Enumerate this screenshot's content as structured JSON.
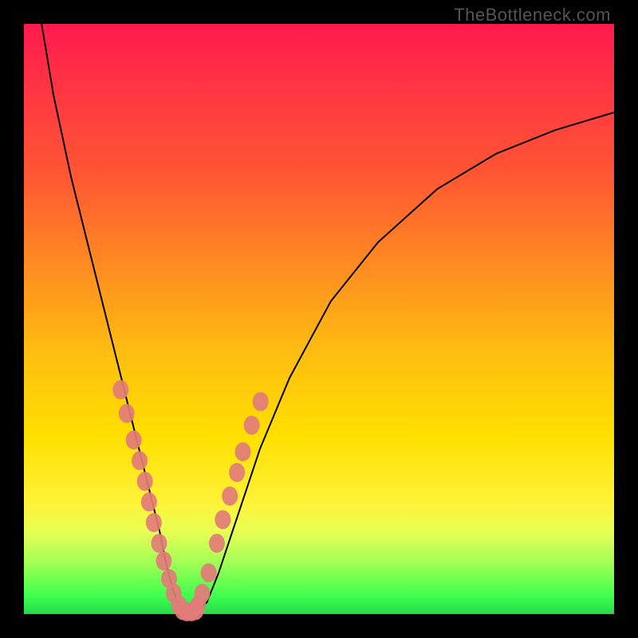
{
  "watermark": "TheBottleneck.com",
  "chart_data": {
    "type": "line",
    "title": "",
    "xlabel": "",
    "ylabel": "",
    "xlim": [
      0,
      100
    ],
    "ylim": [
      0,
      100
    ],
    "grid": false,
    "legend": false,
    "series": [
      {
        "name": "bottleneck-curve",
        "color": "#000000",
        "x": [
          3,
          5,
          8,
          11,
          14,
          16.5,
          18.5,
          20,
          21.5,
          23,
          24,
          25,
          26,
          28,
          29.5,
          31,
          33,
          36,
          40,
          45,
          52,
          60,
          70,
          80,
          90,
          100
        ],
        "y": [
          100,
          88,
          74,
          62,
          50,
          40,
          32,
          26,
          20,
          14,
          9,
          5,
          2,
          0.5,
          0.5,
          2,
          7,
          16,
          28,
          40,
          53,
          63,
          72,
          78,
          82,
          85
        ]
      }
    ],
    "markers": [
      {
        "name": "left-branch-points",
        "color": "#e27c78",
        "points": [
          {
            "x": 16.4,
            "y": 38.0
          },
          {
            "x": 17.4,
            "y": 34.0
          },
          {
            "x": 18.6,
            "y": 29.5
          },
          {
            "x": 19.6,
            "y": 26.0
          },
          {
            "x": 20.5,
            "y": 22.5
          },
          {
            "x": 21.2,
            "y": 19.0
          },
          {
            "x": 22.0,
            "y": 15.5
          },
          {
            "x": 22.9,
            "y": 12.0
          },
          {
            "x": 23.7,
            "y": 9.0
          },
          {
            "x": 24.6,
            "y": 6.0
          },
          {
            "x": 25.4,
            "y": 3.5
          },
          {
            "x": 26.3,
            "y": 1.5
          }
        ]
      },
      {
        "name": "right-branch-points",
        "color": "#e27c78",
        "points": [
          {
            "x": 29.5,
            "y": 1.5
          },
          {
            "x": 30.2,
            "y": 3.5
          },
          {
            "x": 31.3,
            "y": 7.0
          },
          {
            "x": 32.7,
            "y": 12.0
          },
          {
            "x": 33.7,
            "y": 16.0
          },
          {
            "x": 34.9,
            "y": 20.0
          },
          {
            "x": 36.1,
            "y": 24.0
          },
          {
            "x": 37.1,
            "y": 27.5
          },
          {
            "x": 38.6,
            "y": 32.0
          },
          {
            "x": 40.1,
            "y": 36.0
          }
        ]
      },
      {
        "name": "valley-floor-points",
        "color": "#e27c78",
        "points": [
          {
            "x": 26.9,
            "y": 0.6
          },
          {
            "x": 27.6,
            "y": 0.4
          },
          {
            "x": 28.4,
            "y": 0.4
          },
          {
            "x": 29.1,
            "y": 0.6
          }
        ]
      }
    ]
  }
}
